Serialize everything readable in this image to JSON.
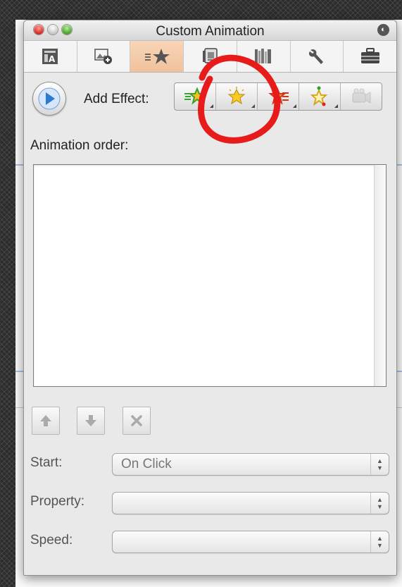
{
  "window": {
    "title": "Custom Animation"
  },
  "toolbar_tabs": [
    {
      "icon": "text-box-icon"
    },
    {
      "icon": "insert-picture-icon"
    },
    {
      "icon": "custom-animation-star-icon",
      "active": true
    },
    {
      "icon": "document-pages-icon"
    },
    {
      "icon": "bookshelf-icon"
    },
    {
      "icon": "wrench-icon"
    },
    {
      "icon": "toolbox-icon"
    }
  ],
  "animation": {
    "play_icon": "play-icon",
    "add_effect_label": "Add Effect:",
    "effects": [
      {
        "icon": "entrance-effect-star-icon"
      },
      {
        "icon": "emphasis-effect-star-icon"
      },
      {
        "icon": "exit-effect-star-icon"
      },
      {
        "icon": "motion-path-star-icon"
      },
      {
        "icon": "movie-action-icon",
        "disabled": true
      }
    ],
    "order_label": "Animation order:"
  },
  "reorder_buttons": [
    {
      "icon": "move-up-arrow-icon"
    },
    {
      "icon": "move-down-arrow-icon"
    },
    {
      "icon": "delete-x-icon"
    }
  ],
  "fields": {
    "start": {
      "label": "Start:",
      "value": "On Click"
    },
    "property": {
      "label": "Property:",
      "value": ""
    },
    "speed": {
      "label": "Speed:",
      "value": ""
    }
  },
  "colors": {
    "annotation_circle": "#e81b1b",
    "active_tab": "#f4c9a6",
    "play_blue": "#2e7ad3"
  }
}
